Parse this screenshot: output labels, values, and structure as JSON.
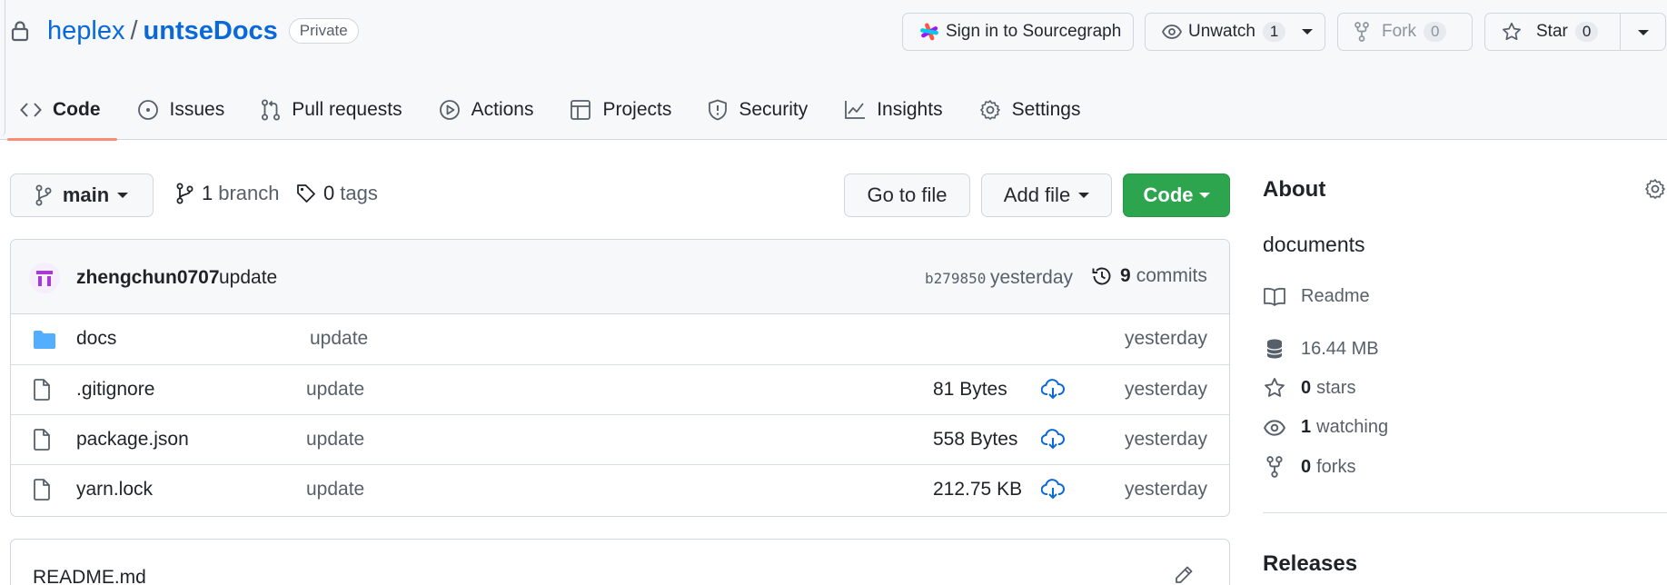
{
  "header": {
    "owner": "heplex",
    "separator": "/",
    "repo": "untseDocs",
    "visibility": "Private",
    "sourcegraph_label": "Sign in to Sourcegraph",
    "unwatch_label": "Unwatch",
    "unwatch_count": "1",
    "fork_label": "Fork",
    "fork_count": "0",
    "star_label": "Star",
    "star_count": "0"
  },
  "tabs": [
    {
      "label": "Code",
      "icon": "code-icon",
      "selected": true
    },
    {
      "label": "Issues",
      "icon": "issue-icon"
    },
    {
      "label": "Pull requests",
      "icon": "pull-request-icon"
    },
    {
      "label": "Actions",
      "icon": "play-icon"
    },
    {
      "label": "Projects",
      "icon": "table-icon"
    },
    {
      "label": "Security",
      "icon": "shield-icon"
    },
    {
      "label": "Insights",
      "icon": "graph-icon"
    },
    {
      "label": "Settings",
      "icon": "gear-icon"
    }
  ],
  "toolbar": {
    "branch": "main",
    "branch_count": "1",
    "branch_label": "branch",
    "tag_count": "0",
    "tag_label": "tags",
    "goto_file": "Go to file",
    "add_file": "Add file",
    "code": "Code"
  },
  "commit": {
    "author": "zhengchun0707",
    "message": "update",
    "hash": "b279850",
    "time": "yesterday",
    "commits_count": "9",
    "commits_label": "commits"
  },
  "files": [
    {
      "name": "docs",
      "type": "folder",
      "message": "update",
      "size": "",
      "date": "yesterday"
    },
    {
      "name": ".gitignore",
      "type": "file",
      "message": "update",
      "size": "81 Bytes",
      "date": "yesterday"
    },
    {
      "name": "package.json",
      "type": "file",
      "message": "update",
      "size": "558 Bytes",
      "date": "yesterday"
    },
    {
      "name": "yarn.lock",
      "type": "file",
      "message": "update",
      "size": "212.75 KB",
      "date": "yesterday"
    }
  ],
  "readme": {
    "title": "README.md"
  },
  "about": {
    "title": "About",
    "description": "documents",
    "readme": "Readme",
    "size": "16.44 MB",
    "stars_count": "0",
    "stars_label": "stars",
    "watching_count": "1",
    "watching_label": "watching",
    "forks_count": "0",
    "forks_label": "forks",
    "releases_title": "Releases"
  },
  "colors": {
    "link": "#0969da",
    "primary_button": "#2da44e",
    "selected_tab_underline": "#fd8c73",
    "folder": "#54aeff"
  }
}
